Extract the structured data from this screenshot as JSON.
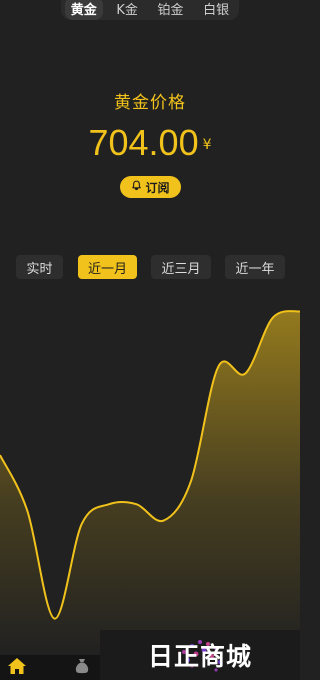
{
  "tabs": [
    {
      "label": "黄金",
      "active": true
    },
    {
      "label": "K金",
      "active": false
    },
    {
      "label": "铂金",
      "active": false
    },
    {
      "label": "白银",
      "active": false
    }
  ],
  "price": {
    "label": "黄金价格",
    "value": "704.00",
    "unit": "¥"
  },
  "subscribe": {
    "label": "订阅",
    "icon": "bell-icon"
  },
  "ranges": [
    {
      "label": "实时",
      "active": false
    },
    {
      "label": "近一月",
      "active": true
    },
    {
      "label": "近三月",
      "active": false
    },
    {
      "label": "近一年",
      "active": false
    }
  ],
  "chart_data": {
    "type": "area",
    "title": "",
    "xlabel": "",
    "ylabel": "",
    "series": [
      {
        "values": [
          0.55,
          0.38,
          0.05,
          0.34,
          0.4,
          0.4,
          0.35,
          0.47,
          0.82,
          0.8,
          0.97,
          0.99
        ]
      }
    ],
    "line_color": "#f1c21b",
    "grid": false
  },
  "bottom_nav": [
    {
      "name": "home",
      "icon": "home-icon",
      "active": true
    },
    {
      "name": "assets",
      "icon": "money-bag-icon",
      "active": false
    }
  ],
  "watermark": {
    "text": "日正商城"
  },
  "colors": {
    "background": "#212121",
    "accent": "#f1c21b",
    "chip": "#2e2e2e"
  }
}
